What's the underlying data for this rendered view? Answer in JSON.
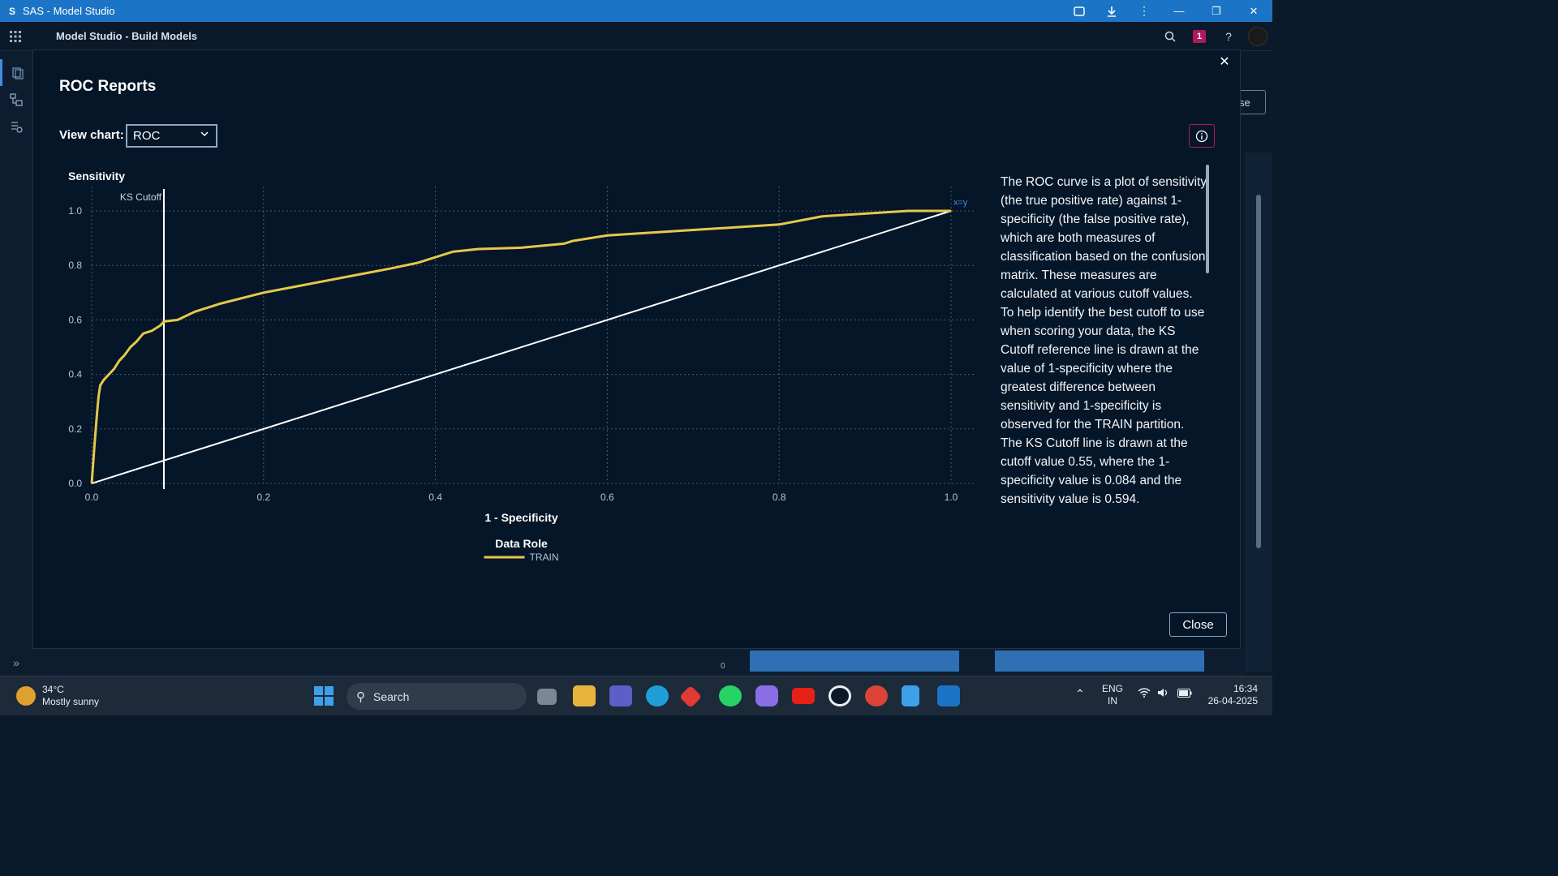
{
  "window": {
    "title": "SAS - Model Studio"
  },
  "app": {
    "title": "Model Studio - Build Models",
    "notification_count": "1"
  },
  "background": {
    "partial_button": "se",
    "axis_zero": "0"
  },
  "dialog": {
    "title": "ROC Reports",
    "view_chart_label": "View chart:",
    "view_chart_value": "ROC",
    "close_label": "Close",
    "description": "The ROC curve is a plot of sensitivity (the true positive rate) against 1-specificity (the false positive rate), which are both measures of classification based on the confusion matrix. These measures are calculated at various cutoff values. To help identify the best cutoff to use when scoring your data, the KS Cutoff reference line is drawn at the value of 1-specificity where the greatest difference between sensitivity and 1-specificity is observed for the TRAIN partition. The KS Cutoff line is drawn at the cutoff value 0.55, where the 1-specificity value is 0.084 and the sensitivity value is 0.594."
  },
  "chart_data": {
    "type": "line",
    "ylabel": "Sensitivity",
    "xlabel": "1 - Specificity",
    "xlim": [
      0,
      1
    ],
    "ylim": [
      0,
      1
    ],
    "xticks": [
      "0.0",
      "0.2",
      "0.4",
      "0.6",
      "0.8",
      "1.0"
    ],
    "yticks": [
      "0.0",
      "0.2",
      "0.4",
      "0.6",
      "0.8",
      "1.0"
    ],
    "grid": true,
    "legend_title": "Data Role",
    "reference_line_label": "KS Cutoff",
    "reference_line_x": 0.084,
    "diagonal_label": "x=y",
    "series": [
      {
        "name": "TRAIN",
        "color": "#e6c84a",
        "x": [
          0,
          0.003,
          0.006,
          0.008,
          0.01,
          0.014,
          0.02,
          0.026,
          0.032,
          0.038,
          0.045,
          0.052,
          0.06,
          0.07,
          0.08,
          0.084,
          0.1,
          0.12,
          0.13,
          0.15,
          0.2,
          0.25,
          0.3,
          0.35,
          0.38,
          0.4,
          0.42,
          0.45,
          0.5,
          0.55,
          0.56,
          0.58,
          0.6,
          0.7,
          0.8,
          0.85,
          0.9,
          0.95,
          1.0
        ],
        "y": [
          0,
          0.13,
          0.25,
          0.32,
          0.36,
          0.38,
          0.4,
          0.42,
          0.45,
          0.47,
          0.5,
          0.52,
          0.55,
          0.56,
          0.58,
          0.594,
          0.6,
          0.63,
          0.64,
          0.66,
          0.7,
          0.73,
          0.76,
          0.79,
          0.81,
          0.83,
          0.85,
          0.86,
          0.865,
          0.88,
          0.89,
          0.9,
          0.91,
          0.93,
          0.95,
          0.98,
          0.99,
          1.0,
          1.0
        ]
      }
    ]
  },
  "taskbar": {
    "weather_temp": "34°C",
    "weather_desc": "Mostly sunny",
    "search_placeholder": "Search",
    "lang": "ENG",
    "region": "IN",
    "time": "16:34",
    "date": "26-04-2025"
  }
}
